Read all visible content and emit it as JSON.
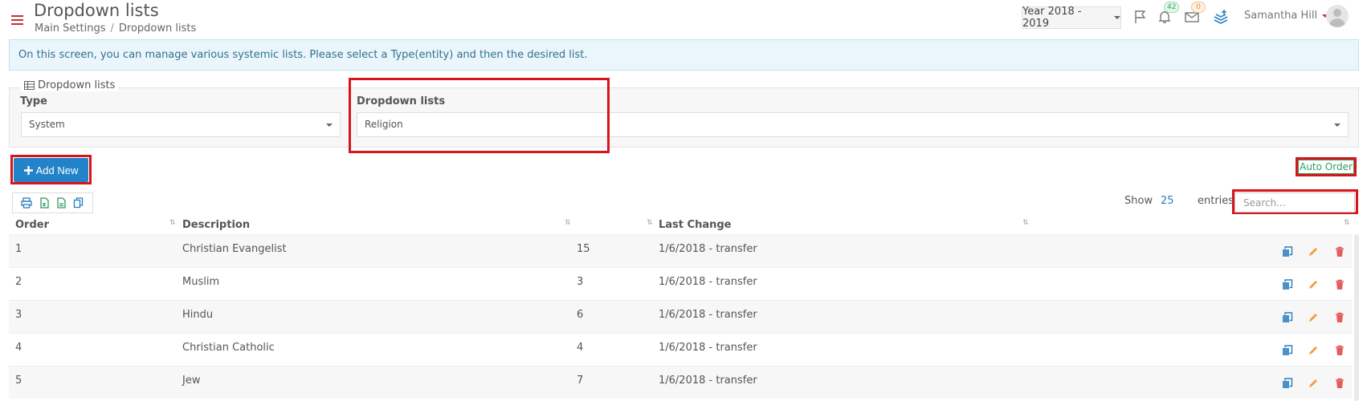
{
  "header": {
    "title": "Dropdown lists",
    "breadcrumb": [
      "Main Settings",
      "Dropdown lists"
    ],
    "year_selector": "Year 2018 - 2019",
    "notifications_count": "42",
    "messages_count": "0",
    "user_name": "Samantha Hill"
  },
  "info": {
    "text": "On this screen, you can manage various systemic lists. Please select a Type(entity) and then the desired list."
  },
  "filters": {
    "legend": "Dropdown lists",
    "type_label": "Type",
    "type_value": "System",
    "list_label": "Dropdown lists",
    "list_value": "Religion"
  },
  "actions": {
    "add_new": "Add New",
    "auto_order": "Auto Order"
  },
  "table_controls": {
    "show_label": "Show",
    "page_size": "25",
    "entries_label": "entries",
    "search_placeholder": "Search..."
  },
  "table": {
    "columns": [
      "Order",
      "Description",
      "Last Change"
    ],
    "rows": [
      {
        "order": "1",
        "description": "Christian Evangelist",
        "count": "15",
        "last_change": "1/6/2018 - transfer"
      },
      {
        "order": "2",
        "description": "Muslim",
        "count": "3",
        "last_change": "1/6/2018 - transfer"
      },
      {
        "order": "3",
        "description": "Hindu",
        "count": "6",
        "last_change": "1/6/2018 - transfer"
      },
      {
        "order": "4",
        "description": "Christian Catholic",
        "count": "4",
        "last_change": "1/6/2018 - transfer"
      },
      {
        "order": "5",
        "description": "Jew",
        "count": "7",
        "last_change": "1/6/2018 - transfer"
      }
    ]
  },
  "colors": {
    "primary": "#2283c8",
    "highlight": "#d9141b",
    "success": "#2e9b62",
    "edit": "#f0a03c",
    "delete": "#e35d5d"
  }
}
